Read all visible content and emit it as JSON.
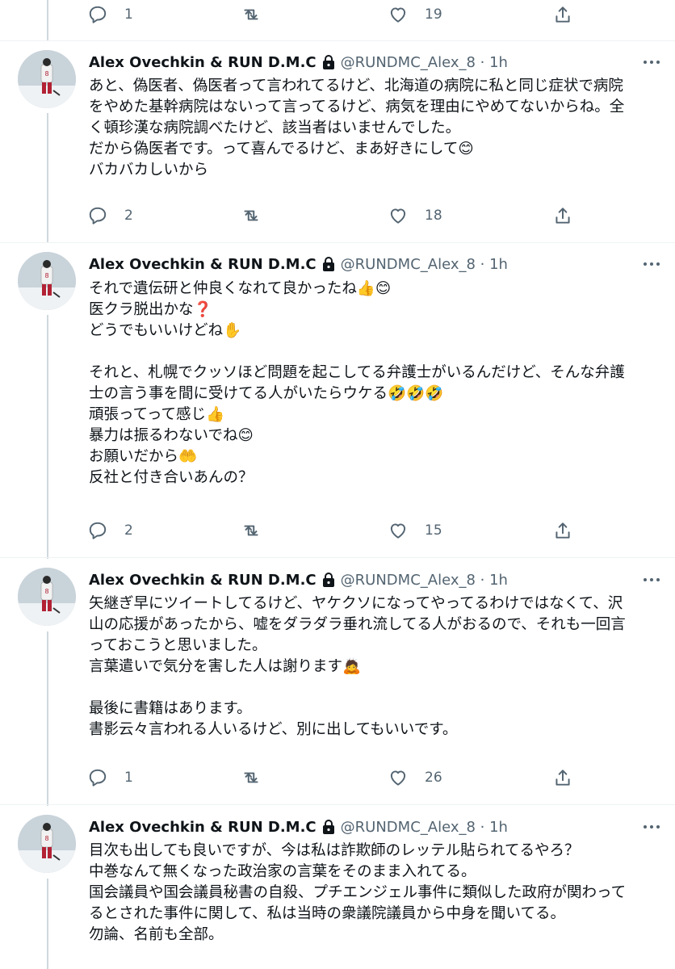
{
  "top_actions": {
    "reply_count": "1",
    "retweet_count": "",
    "like_count": "19"
  },
  "tweets": [
    {
      "name": "Alex Ovechkin & RUN D.M.C",
      "handle_time": "@RUNDMC_Alex_8 · 1h",
      "text": "あと、偽医者、偽医者って言われてるけど、北海道の病院に私と同じ症状で病院\nをやめた基幹病院はないって言ってるけど、病気を理由にやめてないからね。全\nく頓珍漢な病院調べたけど、該当者はいませんでした。\nだから偽医者です。って喜んでるけど、まあ好きにして😊\nバカバカしいから",
      "reply_count": "2",
      "retweet_count": "",
      "like_count": "18"
    },
    {
      "name": "Alex Ovechkin & RUN D.M.C",
      "handle_time": "@RUNDMC_Alex_8 · 1h",
      "text": "それで遺伝研と仲良くなれて良かったね👍😊\n医クラ脱出かな❓\nどうでもいいけどね✋\n\nそれと、札幌でクッソほど問題を起こしてる弁護士がいるんだけど、そんな弁護\n士の言う事を間に受けてる人がいたらウケる🤣🤣🤣\n頑張ってって感じ👍\n暴力は振るわないでね😊\nお願いだから🤲\n反社と付き合いあんの？",
      "reply_count": "2",
      "retweet_count": "",
      "like_count": "15"
    },
    {
      "name": "Alex Ovechkin & RUN D.M.C",
      "handle_time": "@RUNDMC_Alex_8 · 1h",
      "text": "矢継ぎ早にツイートしてるけど、ヤケクソになってやってるわけではなくて、沢\n山の応援があったから、嘘をダラダラ垂れ流してる人がおるので、それも一回言\nっておこうと思いました。\n言葉遣いで気分を害した人は謝ります🙇\n\n最後に書籍はあります。\n書影云々言われる人いるけど、別に出してもいいです。",
      "reply_count": "1",
      "retweet_count": "",
      "like_count": "26"
    },
    {
      "name": "Alex Ovechkin & RUN D.M.C",
      "handle_time": "@RUNDMC_Alex_8 · 1h",
      "text": "目次も出しても良いですが、今は私は詐欺師のレッテル貼られてるやろ？\n中巻なんて無くなった政治家の言葉をそのまま入れてる。\n国会議員や国会議員秘書の自殺、プチエンジェル事件に類似した政府が関わって\nるとされた事件に関して、私は当時の衆議院議員から中身を聞いてる。\n勿論、名前も全部。"
    }
  ]
}
